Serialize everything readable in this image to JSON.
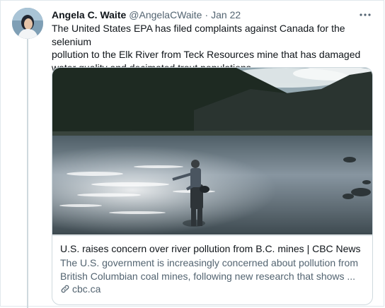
{
  "tweet": {
    "author_name": "Angela C. Waite",
    "author_handle": "@AngelaCWaite",
    "separator": "·",
    "date": "Jan 22",
    "text": "The United States EPA has filed complaints against Canada for the selenium\npollution to the Elk River from  Teck Resources mine that has damaged\nwater quality and decimated trout populations.",
    "more_icon": "more-horizontal-icon"
  },
  "card": {
    "title": "U.S. raises concern over river pollution from B.C. mines | CBC News",
    "description": "The U.S. government is increasingly concerned about pollution from\nBritish Columbian coal mines, following new research that shows ...",
    "domain": "cbc.ca",
    "domain_icon": "link-icon"
  },
  "colors": {
    "text_primary": "#0f1419",
    "text_secondary": "#536471",
    "border": "#cfd9de"
  }
}
